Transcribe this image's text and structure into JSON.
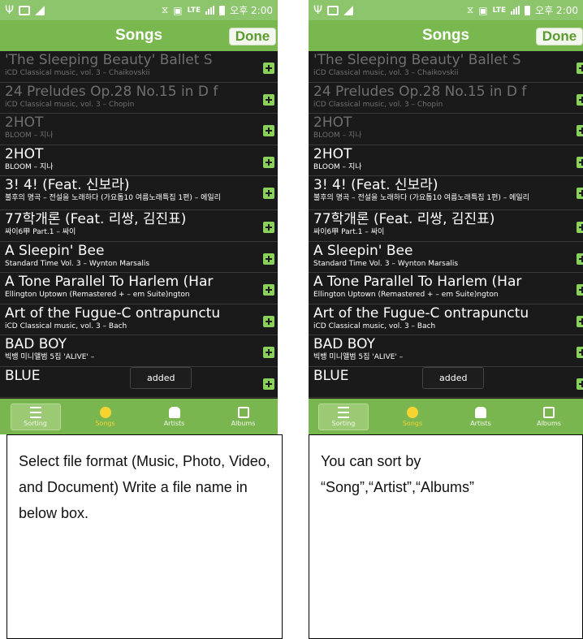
{
  "status_bar": {
    "time": "오후 2:00",
    "network": "LTE"
  },
  "header": {
    "title": "Songs",
    "done_label": "Done"
  },
  "songs": [
    {
      "title": "'The Sleeping Beauty' Ballet S",
      "subtitle": "iCD Classical music, vol. 3 – Chaikovskii",
      "dim": true
    },
    {
      "title": "24 Preludes Op.28 No.15 in D f",
      "subtitle": "iCD Classical music, vol. 3 – Chopin",
      "dim": true
    },
    {
      "title": "2HOT",
      "subtitle": "BLOOM – 지나",
      "dim": true
    },
    {
      "title": "2HOT",
      "subtitle": "BLOOM – 지나",
      "dim": false
    },
    {
      "title": "3! 4! (Feat. 신보라)",
      "subtitle": "불후의 명곡 – 전설을 노래하다 (가요톱10 여름노래특집 1편) – 에일리",
      "dim": false
    },
    {
      "title": "77학개론 (Feat. 리쌍, 김진표)",
      "subtitle": "싸이6甲 Part.1 – 싸이",
      "dim": false
    },
    {
      "title": "A Sleepin' Bee",
      "subtitle": "Standard Time Vol. 3 – Wynton Marsalis",
      "dim": false
    },
    {
      "title": "A Tone Parallel To Harlem (Har",
      "subtitle": "Ellington Uptown (Remastered + – em Suite)ngton",
      "dim": false
    },
    {
      "title": "Art of the Fugue-C ontrapunctu",
      "subtitle": "iCD Classical music, vol. 3 – Bach",
      "dim": false
    },
    {
      "title": "BAD BOY",
      "subtitle": "빅뱅 미니앨범 5집 'ALIVE' –",
      "dim": false
    },
    {
      "title": "BLUE",
      "subtitle": "",
      "dim": false
    }
  ],
  "toast": "added",
  "tabs": [
    "Sorting",
    "Songs",
    "Artists",
    "Albums"
  ],
  "captions": {
    "left": "Select file format (Music, Photo, Video, and Document) Write a file name in below box.",
    "right": "You can sort by “Song”,“Artist”,“Albums”"
  },
  "colors": {
    "accent": "#79b84f",
    "status_bar": "#8cc56b",
    "list_bg": "#1a1a1a",
    "plus": "#8ad15c",
    "song_tab": "#f5d432"
  },
  "icons": [
    "usb-icon",
    "image-icon",
    "signal-icon",
    "vibrate-icon",
    "sync-icon",
    "battery-icon",
    "plus-icon",
    "sort-icon",
    "song-icon",
    "artist-icon",
    "album-icon"
  ]
}
